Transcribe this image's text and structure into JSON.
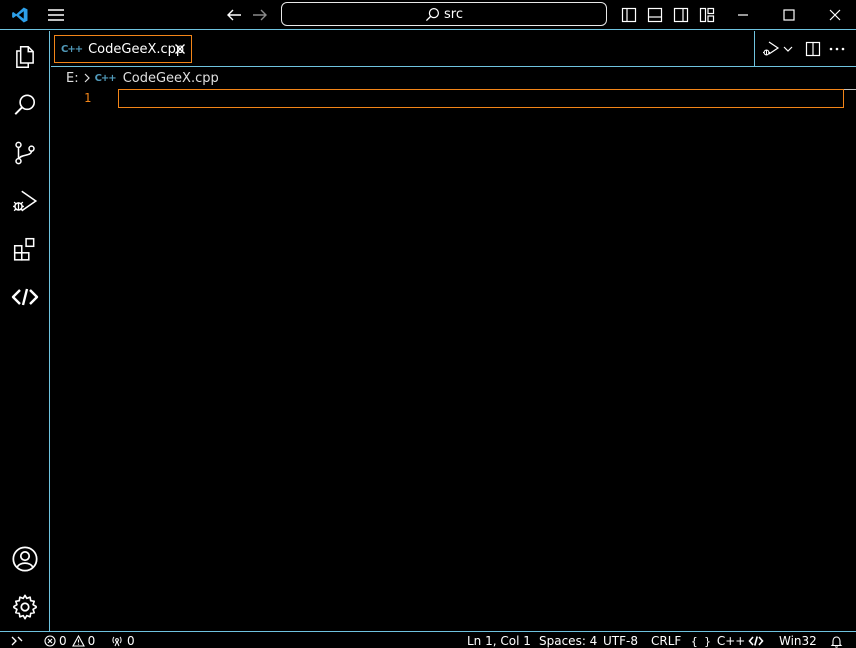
{
  "titlebar": {
    "search_text": "src"
  },
  "activity": {
    "items": [
      "explorer-icon",
      "search-icon",
      "source-control-icon",
      "run-debug-icon",
      "extensions-icon",
      "codegeex-icon"
    ],
    "bottom": [
      "account-icon",
      "settings-gear-icon"
    ]
  },
  "tabs": [
    {
      "label": "CodeGeeX.cpp",
      "icon": "C++"
    }
  ],
  "breadcrumb": {
    "drive": "E:",
    "file": "CodeGeeX.cpp",
    "icon": "C++"
  },
  "editor": {
    "line_numbers": [
      "1"
    ]
  },
  "statusbar": {
    "errors": "0",
    "warnings": "0",
    "ports": "0",
    "position": "Ln 1, Col 1",
    "spaces": "Spaces: 4",
    "encoding": "UTF-8",
    "eol": "CRLF",
    "language": "C++",
    "language_braces": "{ }",
    "platform": "Win32"
  },
  "colors": {
    "contrast_border": "#6fc3df",
    "active_border": "#f38518",
    "vscode_blue": "#2d9fe8",
    "cpp_icon": "#519aba"
  }
}
